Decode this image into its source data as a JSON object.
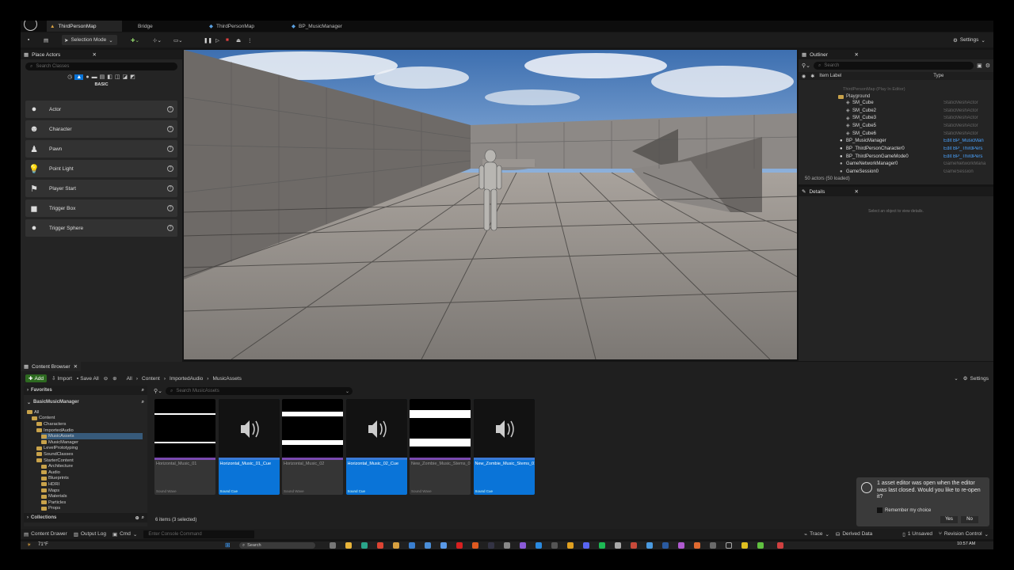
{
  "tabs": [
    {
      "label": "ThirdPersonMap"
    },
    {
      "label": "Bridge"
    },
    {
      "label": "ThirdPersonMap"
    },
    {
      "label": "BP_MusicManager"
    }
  ],
  "toolbar": {
    "selection_mode": "Selection Mode",
    "settings": "Settings"
  },
  "place_actors": {
    "title": "Place Actors",
    "search_placeholder": "Search Classes",
    "category": "BASIC",
    "items": [
      {
        "label": "Actor",
        "icon": "sphere-icon"
      },
      {
        "label": "Character",
        "icon": "character-icon"
      },
      {
        "label": "Pawn",
        "icon": "pawn-icon"
      },
      {
        "label": "Point Light",
        "icon": "light-bulb-icon"
      },
      {
        "label": "Player Start",
        "icon": "flag-icon"
      },
      {
        "label": "Trigger Box",
        "icon": "trigger-box-icon"
      },
      {
        "label": "Trigger Sphere",
        "icon": "trigger-sphere-icon"
      }
    ]
  },
  "outliner": {
    "title": "Outliner",
    "search_placeholder": "Search",
    "col_label": "Item Label",
    "col_type": "Type",
    "map_row": "ThirdPersonMap (Play In Editor)",
    "folder": "Playground",
    "rows": [
      {
        "label": "SM_Cube",
        "type": "StaticMeshActor"
      },
      {
        "label": "SM_Cube2",
        "type": "StaticMeshActor"
      },
      {
        "label": "SM_Cube3",
        "type": "StaticMeshActor"
      },
      {
        "label": "SM_Cube5",
        "type": "StaticMeshActor"
      },
      {
        "label": "SM_Cube6",
        "type": "StaticMeshActor"
      },
      {
        "label": "BP_MusicManager",
        "type": "Edit BP_MusicMan"
      },
      {
        "label": "BP_ThirdPersonCharacter0",
        "type": "Edit BP_ThirdPers"
      },
      {
        "label": "BP_ThirdPersonGameMode0",
        "type": "Edit BP_ThirdPers"
      },
      {
        "label": "GameNetworkManager0",
        "type": "GameNetworkMana"
      },
      {
        "label": "GameSession0",
        "type": "GameSession"
      }
    ],
    "count": "50 actors (50 loaded)"
  },
  "details": {
    "title": "Details",
    "empty": "Select an object to view details."
  },
  "content_browser": {
    "title": "Content Browser",
    "add": "Add",
    "import": "Import",
    "save_all": "Save All",
    "breadcrumb": [
      "All",
      "Content",
      "ImportedAudio",
      "MusicAssets"
    ],
    "settings": "Settings",
    "favorites": "Favorites",
    "project": "BasicMusicManager",
    "collections": "Collections",
    "search_placeholder": "Search MusicAssets",
    "status": "6 items (3 selected)",
    "tree": [
      {
        "label": "All"
      },
      {
        "label": "Content"
      },
      {
        "label": "Characters"
      },
      {
        "label": "ImportedAudio"
      },
      {
        "label": "MusicAssets"
      },
      {
        "label": "MusicManager"
      },
      {
        "label": "LevelPrototyping"
      },
      {
        "label": "SoundClasses"
      },
      {
        "label": "StarterContent"
      },
      {
        "label": "Architecture"
      },
      {
        "label": "Audio"
      },
      {
        "label": "Blueprints"
      },
      {
        "label": "HDRI"
      },
      {
        "label": "Maps"
      },
      {
        "label": "Materials"
      },
      {
        "label": "Particles"
      },
      {
        "label": "Props"
      }
    ],
    "assets": [
      {
        "name": "Horizontal_Music_01",
        "type": "Sound Wave",
        "selected": false
      },
      {
        "name": "Horizontal_Music_01_Cue",
        "type": "Sound Cue",
        "selected": true
      },
      {
        "name": "Horizontal_Music_02",
        "type": "Sound Wave",
        "selected": false
      },
      {
        "name": "Horizontal_Music_02_Cue",
        "type": "Sound Cue",
        "selected": true
      },
      {
        "name": "New_Zombie_Music_Stems_01",
        "type": "Sound Wave",
        "selected": false
      },
      {
        "name": "New_Zombie_Music_Stems_01_Cue",
        "type": "Sound Cue",
        "selected": true
      }
    ]
  },
  "notification": {
    "message": "1 asset editor was open when the editor was last closed. Would you like to re-open it?",
    "checkbox": "Remember my choice",
    "yes": "Yes",
    "no": "No"
  },
  "statusbar": {
    "content_drawer": "Content Drawer",
    "output_log": "Output Log",
    "cmd": "Cmd",
    "console_placeholder": "Enter Console Command",
    "trace": "Trace",
    "derived_data": "Derived Data",
    "unsaved": "1 Unsaved",
    "revision": "Revision Control"
  },
  "taskbar": {
    "search": "Search",
    "time": "10:57 AM",
    "temp": "71°F"
  },
  "colors": {
    "accent": "#0a74d8",
    "folder": "#c8a24a",
    "link": "#4aa3ff"
  }
}
